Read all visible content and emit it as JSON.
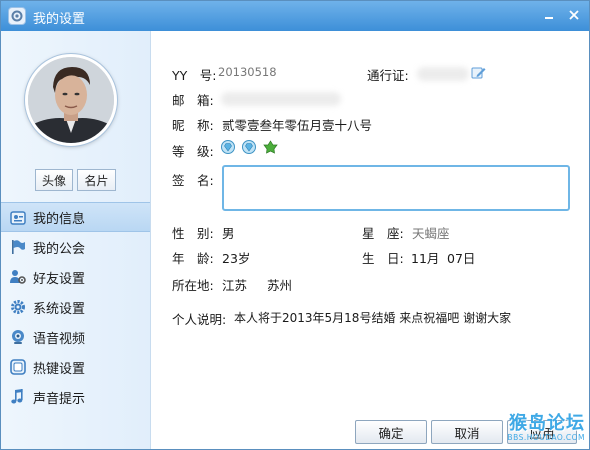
{
  "window": {
    "title": "我的设置"
  },
  "profile": {
    "btn_avatar": "头像",
    "btn_card": "名片"
  },
  "sidebar": {
    "items": [
      {
        "label": "我的信息",
        "icon": "profile-icon"
      },
      {
        "label": "我的公会",
        "icon": "flag-icon"
      },
      {
        "label": "好友设置",
        "icon": "friend-settings-icon"
      },
      {
        "label": "系统设置",
        "icon": "gear-icon"
      },
      {
        "label": "语音视频",
        "icon": "webcam-icon"
      },
      {
        "label": "热键设置",
        "icon": "hotkey-icon"
      },
      {
        "label": "声音提示",
        "icon": "music-note-icon"
      }
    ]
  },
  "info": {
    "yy_label": "YY　号:",
    "yy_value": "20130518",
    "pass_label": "通行证:",
    "email_label": "邮　箱:",
    "nick_label": "昵　称:",
    "nick_value": "贰零壹叁年零伍月壹十八号",
    "level_label": "等　级:",
    "sig_label": "签　名:",
    "gender_label": "性　别:",
    "gender_value": "男",
    "star_label": "星　座:",
    "star_value": "天蝎座",
    "age_label": "年　龄:",
    "age_value": "23岁",
    "birth_label": "生　日:",
    "birth_month": "11月",
    "birth_day": "07日",
    "loc_label": "所在地:",
    "loc_province": "江苏",
    "loc_city": "苏州",
    "desc_label": "个人说明:",
    "desc_value": "本人将于2013年5月18号结婚 来点祝福吧 谢谢大家"
  },
  "buttons": {
    "ok": "确定",
    "cancel": "取消",
    "apply": "应用"
  },
  "watermark": {
    "text": "猴岛论坛",
    "url": "BBS.HOUDAO.COM"
  },
  "colors": {
    "titlebar": "#4a9be0",
    "accent": "#6fb6e6",
    "active_nav": "#c4ddf6"
  }
}
